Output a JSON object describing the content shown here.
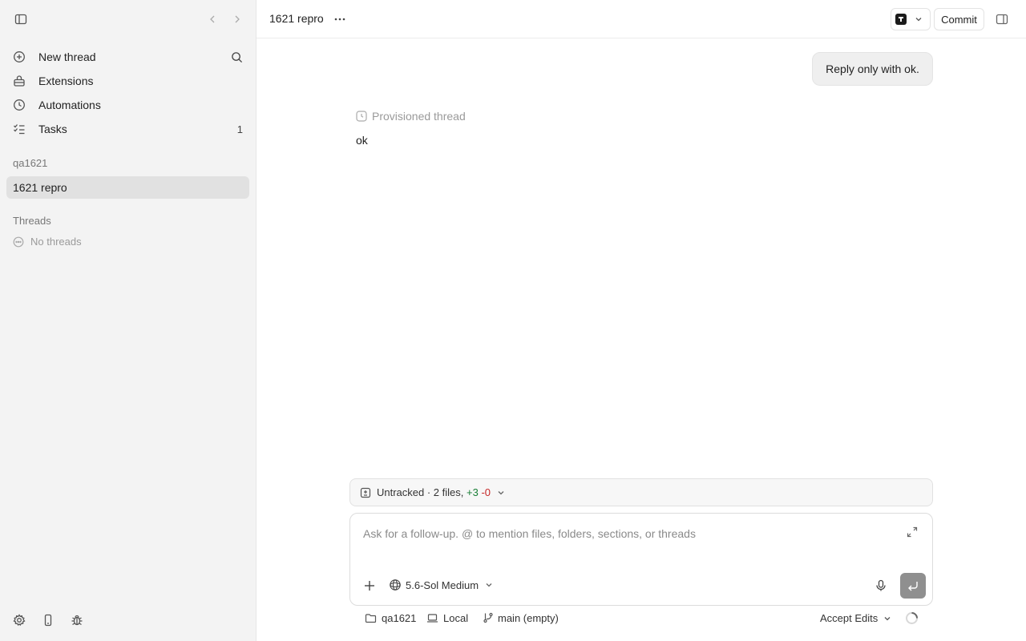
{
  "sidebar": {
    "nav": [
      {
        "label": "New thread",
        "icon": "plus-circle-icon"
      },
      {
        "label": "Extensions",
        "icon": "extensions-icon"
      },
      {
        "label": "Automations",
        "icon": "clock-icon"
      },
      {
        "label": "Tasks",
        "icon": "checklist-icon",
        "count": "1"
      }
    ],
    "project_section": "qa1621",
    "project_item": "1621 repro",
    "threads_section": "Threads",
    "no_threads": "No threads"
  },
  "header": {
    "title": "1621 repro",
    "commit_label": "Commit"
  },
  "conversation": {
    "user_message": "Reply only with ok.",
    "status_label": "Provisioned thread",
    "assistant_reply": "ok"
  },
  "diff": {
    "label": "Untracked · 2 files,",
    "additions": "+3",
    "deletions": "-0"
  },
  "composer": {
    "placeholder": "Ask for a follow-up. @ to mention files, folders, sections, or threads",
    "model": "5.6-Sol Medium"
  },
  "status_bar": {
    "folder": "qa1621",
    "location": "Local",
    "branch": "main (empty)",
    "mode": "Accept Edits"
  },
  "colors": {
    "additions": "#1a7f37",
    "deletions": "#c62828",
    "selected_item": "#e1e1e1"
  }
}
